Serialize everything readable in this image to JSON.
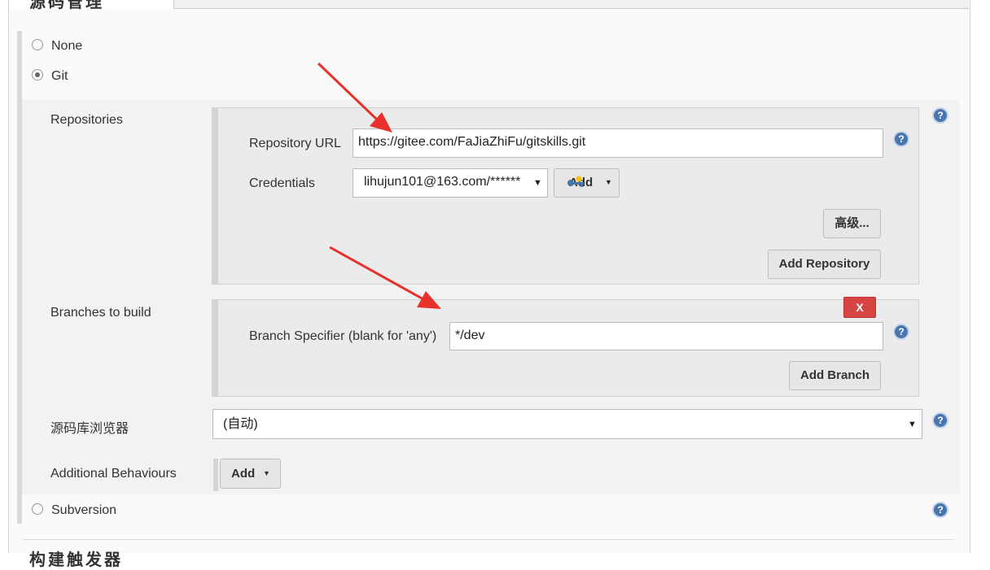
{
  "section_title": "源码管理",
  "next_section_title": "构建触发器",
  "scm_options": {
    "none": "None",
    "git": "Git",
    "subversion": "Subversion"
  },
  "git": {
    "repositories_label": "Repositories",
    "repository_url_label": "Repository URL",
    "repository_url_value": "https://gitee.com/FaJiaZhiFu/gitskills.git",
    "credentials_label": "Credentials",
    "credentials_value": "lihujun101@163.com/******",
    "add_credentials_label": "Add",
    "advanced_label": "高级...",
    "add_repository_label": "Add Repository",
    "branches_label": "Branches to build",
    "delete_branch_label": "X",
    "branch_specifier_label": "Branch Specifier (blank for 'any')",
    "branch_specifier_value": "*/dev",
    "add_branch_label": "Add Branch",
    "repo_browser_label": "源码库浏览器",
    "repo_browser_value": "(自动)",
    "additional_behaviours_label": "Additional Behaviours",
    "add_behaviour_label": "Add"
  },
  "help_icon_text": "?",
  "colors": {
    "arrow": "#e8312b",
    "help_icon": "#4a76b0",
    "delete_button": "#d64541"
  }
}
